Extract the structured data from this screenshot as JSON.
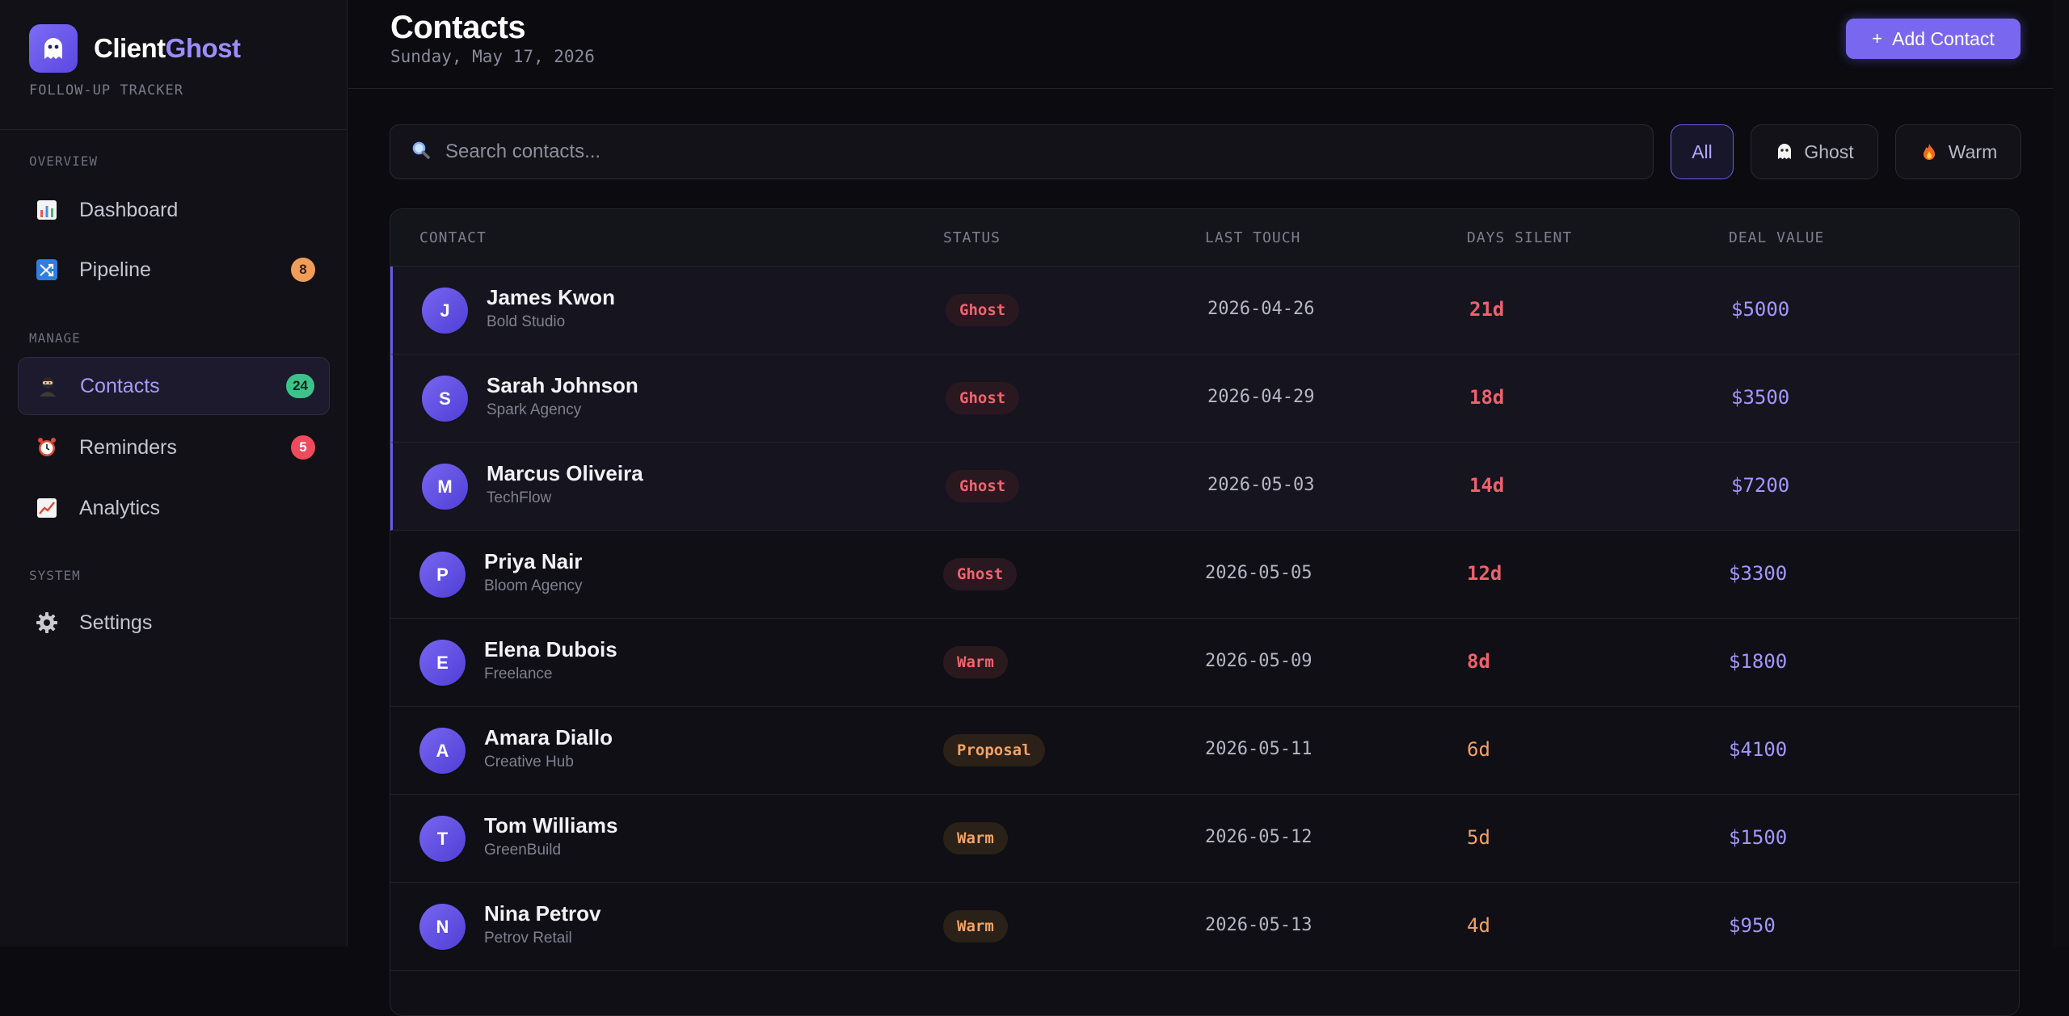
{
  "brand": {
    "name_part1": "Client",
    "name_part2": "Ghost",
    "tagline": "FOLLOW-UP TRACKER"
  },
  "sidebar": {
    "sections": [
      {
        "label": "OVERVIEW"
      },
      {
        "label": "MANAGE"
      },
      {
        "label": "SYSTEM"
      }
    ],
    "items": [
      {
        "label": "Dashboard",
        "icon": "bar-chart-icon",
        "badge": ""
      },
      {
        "label": "Pipeline",
        "icon": "shuffle-icon",
        "badge": "8"
      },
      {
        "label": "Contacts",
        "icon": "ninja-icon",
        "badge": "24"
      },
      {
        "label": "Reminders",
        "icon": "alarm-clock-icon",
        "badge": "5"
      },
      {
        "label": "Analytics",
        "icon": "trend-chart-icon",
        "badge": ""
      },
      {
        "label": "Settings",
        "icon": "gear-icon",
        "badge": ""
      }
    ]
  },
  "header": {
    "title": "Contacts",
    "date": "Sunday, May 17, 2026",
    "add_label": "Add Contact"
  },
  "search": {
    "placeholder": "Search contacts..."
  },
  "filters": [
    {
      "label": "All",
      "icon": "",
      "active": true
    },
    {
      "label": "Ghost",
      "icon": "ghost-icon",
      "active": false
    },
    {
      "label": "Warm",
      "icon": "fire-icon",
      "active": false
    }
  ],
  "table": {
    "columns": [
      "CONTACT",
      "STATUS",
      "LAST TOUCH",
      "DAYS SILENT",
      "DEAL VALUE"
    ],
    "rows": [
      {
        "initial": "J",
        "name": "James Kwon",
        "company": "Bold Studio",
        "status": "Ghost",
        "last_touch": "2026-04-26",
        "days_silent": "21d",
        "deal_value": "$5000"
      },
      {
        "initial": "S",
        "name": "Sarah Johnson",
        "company": "Spark Agency",
        "status": "Ghost",
        "last_touch": "2026-04-29",
        "days_silent": "18d",
        "deal_value": "$3500"
      },
      {
        "initial": "M",
        "name": "Marcus Oliveira",
        "company": "TechFlow",
        "status": "Ghost",
        "last_touch": "2026-05-03",
        "days_silent": "14d",
        "deal_value": "$7200"
      },
      {
        "initial": "P",
        "name": "Priya Nair",
        "company": "Bloom Agency",
        "status": "Ghost",
        "last_touch": "2026-05-05",
        "days_silent": "12d",
        "deal_value": "$3300"
      },
      {
        "initial": "E",
        "name": "Elena Dubois",
        "company": "Freelance",
        "status": "Warm",
        "last_touch": "2026-05-09",
        "days_silent": "8d",
        "deal_value": "$1800"
      },
      {
        "initial": "A",
        "name": "Amara Diallo",
        "company": "Creative Hub",
        "status": "Proposal",
        "last_touch": "2026-05-11",
        "days_silent": "6d",
        "deal_value": "$4100"
      },
      {
        "initial": "T",
        "name": "Tom Williams",
        "company": "GreenBuild",
        "status": "Warm",
        "last_touch": "2026-05-12",
        "days_silent": "5d",
        "deal_value": "$1500"
      },
      {
        "initial": "N",
        "name": "Nina Petrov",
        "company": "Petrov Retail",
        "status": "Warm",
        "last_touch": "2026-05-13",
        "days_silent": "4d",
        "deal_value": "$950"
      }
    ]
  },
  "colors": {
    "accent": "#7a67f0",
    "danger": "#f0606c",
    "warning": "#f0a262",
    "value": "#a596ff"
  }
}
